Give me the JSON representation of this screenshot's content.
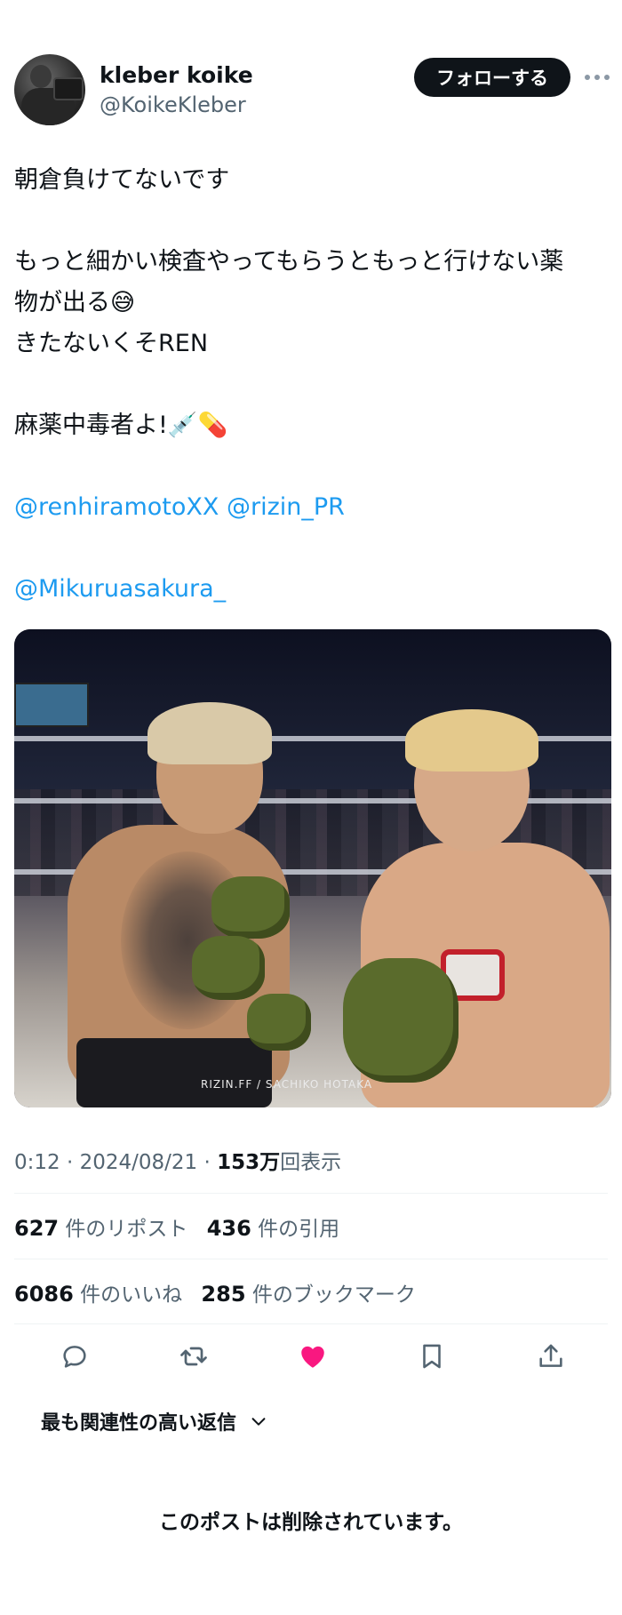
{
  "author": {
    "name": "kleber koike",
    "handle": "@KoikeKleber"
  },
  "follow_label": "フォローする",
  "tweet": {
    "line1": "朝倉負けてないです",
    "line2": "もっと細かい検査やってもらうともっと行けない薬",
    "line3": "物が出る😅",
    "line4": "きたないくそREN",
    "line5": "麻薬中毒者よ!💉💊",
    "mention1": "@renhiramotoXX",
    "mention2": "@rizin_PR",
    "mention3": "@Mikuruasakura_"
  },
  "media": {
    "credit": "RIZIN.FF / SACHIKO HOTAKA"
  },
  "meta": {
    "time": "0:12",
    "date": "2024/08/21",
    "views_count": "153万",
    "views_label": "回表示"
  },
  "stats": {
    "reposts_count": "627",
    "reposts_label": "件のリポスト",
    "quotes_count": "436",
    "quotes_label": "件の引用",
    "likes_count": "6086",
    "likes_label": "件のいいね",
    "bookmarks_count": "285",
    "bookmarks_label": "件のブックマーク"
  },
  "actions": {
    "icons": [
      "reply-icon",
      "repost-icon",
      "like-icon",
      "bookmark-icon",
      "share-icon"
    ],
    "like_color": "#f91880",
    "icon_color": "#536471"
  },
  "replies_filter": "最も関連性の高い返信",
  "deleted_notice": "このポストは削除されています。"
}
